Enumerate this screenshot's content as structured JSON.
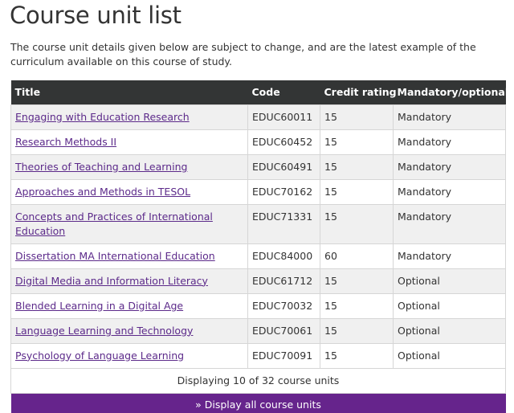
{
  "page": {
    "title": "Course unit list",
    "intro": "The course unit details given below are subject to change, and are the latest example of the curriculum available on this course of study."
  },
  "table": {
    "headers": [
      "Title",
      "Code",
      "Credit rating",
      "Mandatory/optional"
    ],
    "rows": [
      {
        "title": "Engaging with Education Research",
        "code": "EDUC60011",
        "credit": "15",
        "status": "Mandatory"
      },
      {
        "title": "Research Methods II",
        "code": "EDUC60452",
        "credit": "15",
        "status": "Mandatory"
      },
      {
        "title": "Theories of Teaching and Learning",
        "code": "EDUC60491",
        "credit": "15",
        "status": "Mandatory"
      },
      {
        "title": "Approaches and Methods in TESOL",
        "code": "EDUC70162",
        "credit": "15",
        "status": "Mandatory"
      },
      {
        "title": "Concepts and Practices of International Education",
        "code": "EDUC71331",
        "credit": "15",
        "status": "Mandatory"
      },
      {
        "title": "Dissertation MA International Education",
        "code": "EDUC84000",
        "credit": "60",
        "status": "Mandatory"
      },
      {
        "title": "Digital Media and Information Literacy",
        "code": "EDUC61712",
        "credit": "15",
        "status": "Optional"
      },
      {
        "title": "Blended Learning in a Digital Age",
        "code": "EDUC70032",
        "credit": "15",
        "status": "Optional"
      },
      {
        "title": "Language Learning and Technology",
        "code": "EDUC70061",
        "credit": "15",
        "status": "Optional"
      },
      {
        "title": "Psychology of Language Learning",
        "code": "EDUC70091",
        "credit": "15",
        "status": "Optional"
      }
    ],
    "footer": {
      "count_text": "Displaying 10 of 32 course units",
      "show_all_label": "» Display all course units"
    }
  },
  "colors": {
    "header_bg": "#333535",
    "link": "#5c2a8a",
    "button_bg": "#66248c",
    "row_alt_bg": "#f0f0f0"
  }
}
